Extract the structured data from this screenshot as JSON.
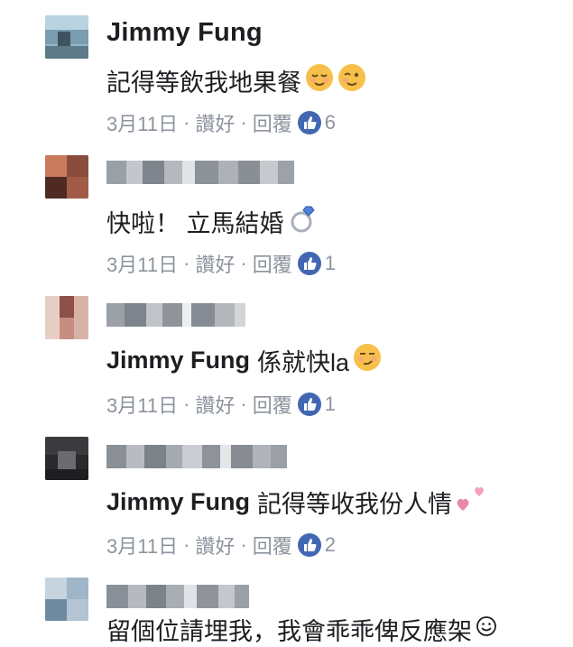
{
  "comments": [
    {
      "author": "Jimmy Fung",
      "text": "記得等飲我地果餐",
      "date": "3月11日",
      "like_label": "讚好",
      "reply_label": "回覆",
      "likes": "6",
      "emojis": [
        "relieved-face-icon",
        "winking-face-icon"
      ]
    },
    {
      "author": "",
      "text": "快啦！ 立馬結婚",
      "date": "3月11日",
      "like_label": "讚好",
      "reply_label": "回覆",
      "likes": "1",
      "emojis": [
        "ring-icon"
      ]
    },
    {
      "author": "",
      "mention": "Jimmy Fung",
      "text": "係就快la",
      "date": "3月11日",
      "like_label": "讚好",
      "reply_label": "回覆",
      "likes": "1",
      "emojis": [
        "smirking-face-icon"
      ]
    },
    {
      "author": "",
      "mention": "Jimmy Fung",
      "text": "記得等收我份人情",
      "date": "3月11日",
      "like_label": "讚好",
      "reply_label": "回覆",
      "likes": "2",
      "emojis": [
        "two-hearts-icon"
      ]
    },
    {
      "author": "",
      "text": "留個位請埋我，我會乖乖俾反應架",
      "emojis": [
        "smiley-icon"
      ]
    }
  ],
  "meta_separator": "·",
  "colors": {
    "like_badge": "#4267b2",
    "meta_text": "#8d949e",
    "primary_text": "#1c1e21"
  }
}
